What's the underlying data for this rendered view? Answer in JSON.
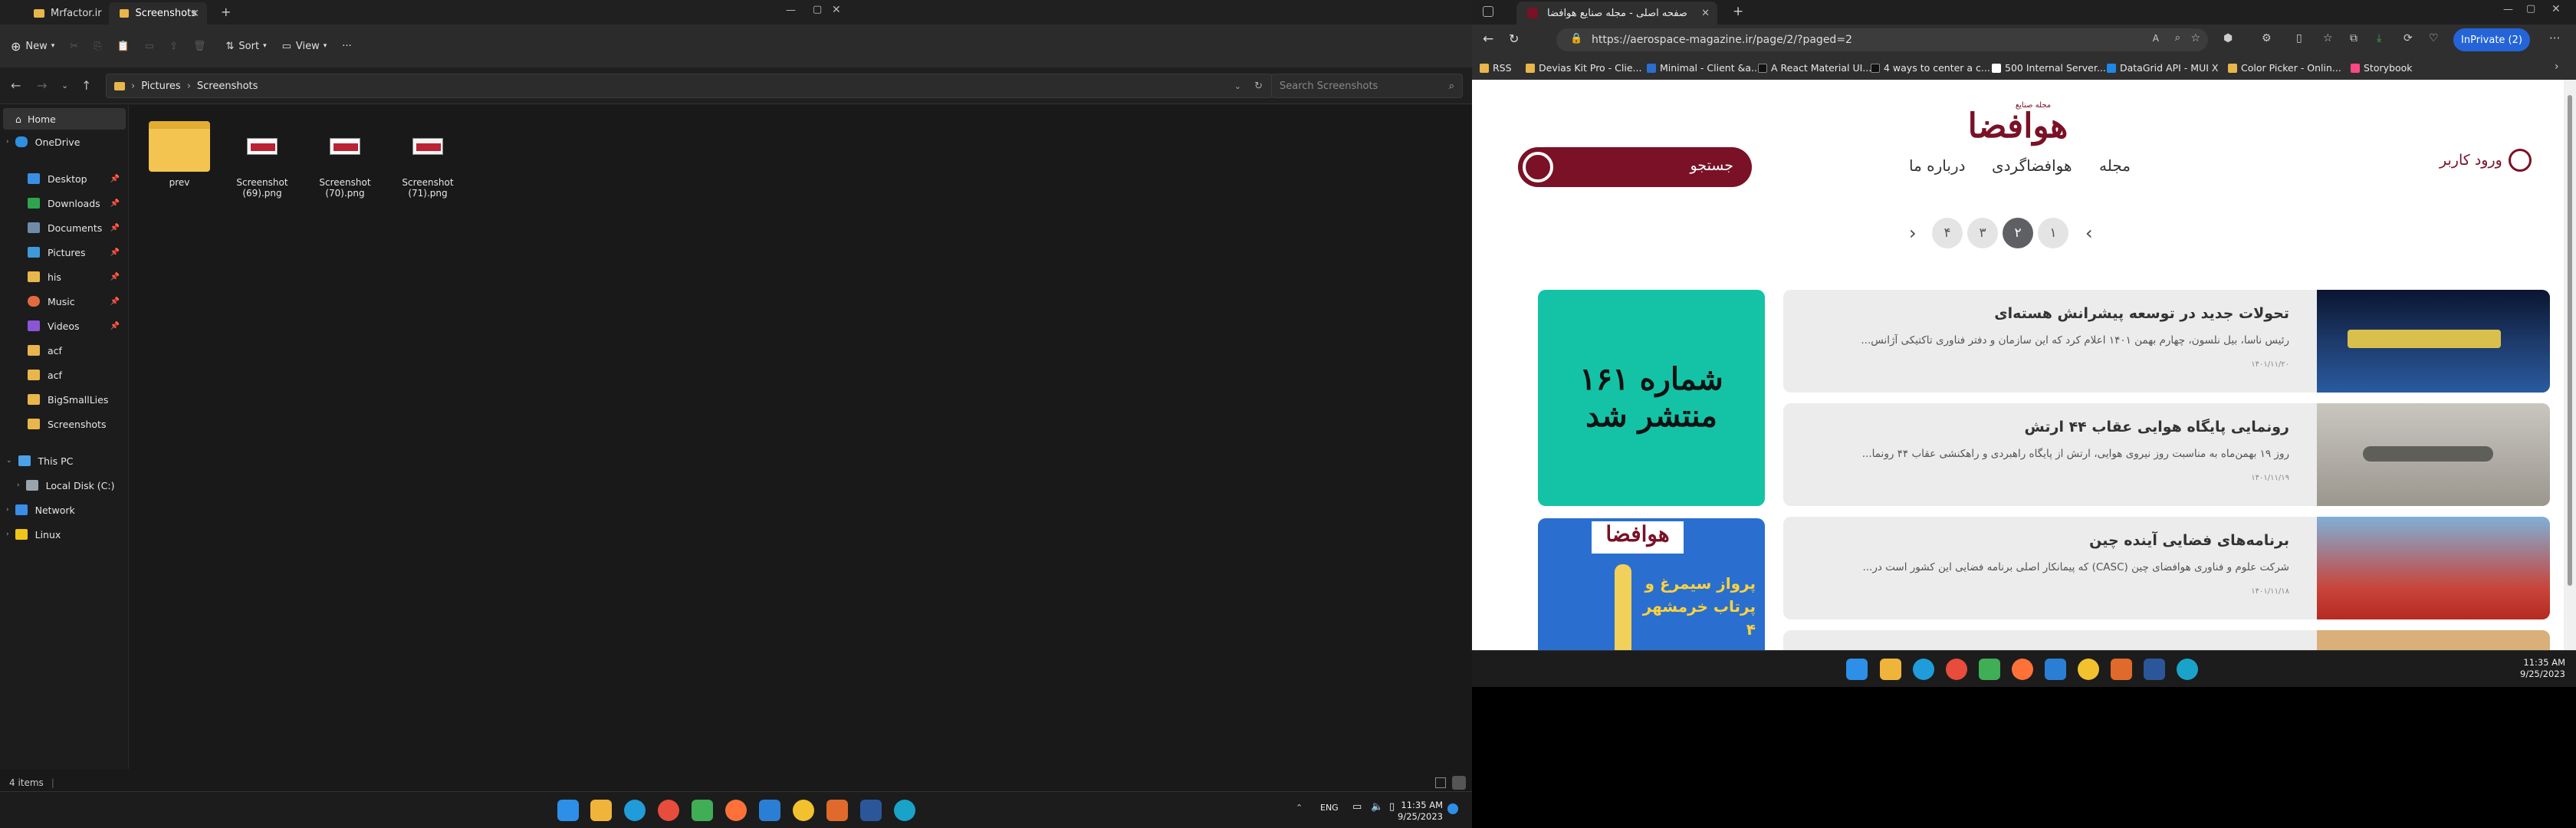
{
  "explorer": {
    "tabs": [
      {
        "label": "Mrfactor.ir"
      },
      {
        "label": "Screenshots"
      }
    ],
    "toolbar": {
      "new_label": "New",
      "sort_label": "Sort",
      "view_label": "View"
    },
    "breadcrumb": [
      "Pictures",
      "Screenshots"
    ],
    "search_placeholder": "Search Screenshots",
    "sidebar": {
      "home": "Home",
      "onedrive": "OneDrive",
      "pinned": [
        "Desktop",
        "Downloads",
        "Documents",
        "Pictures",
        "his",
        "Music",
        "Videos",
        "acf",
        "acf",
        "BigSmallLies",
        "Screenshots"
      ],
      "this_pc": "This PC",
      "local_disk": "Local Disk (C:)",
      "network": "Network",
      "linux": "Linux"
    },
    "files": [
      {
        "name": "prev",
        "kind": "folder"
      },
      {
        "name": "Screenshot (69).png",
        "kind": "image"
      },
      {
        "name": "Screenshot (70).png",
        "kind": "image"
      },
      {
        "name": "Screenshot (71).png",
        "kind": "image"
      }
    ],
    "status": "4 items"
  },
  "taskbar": {
    "lang": "ENG",
    "time": "11:35 AM",
    "date": "9/25/2023"
  },
  "browser": {
    "tab_title": "صفحه اصلی - مجله صنایع هوافضا",
    "url": "https://aerospace-magazine.ir/page/2/?paged=2",
    "inprivate_label": "InPrivate (2)",
    "bookmarks": [
      "RSS",
      "Devias Kit Pro - Clie...",
      "Minimal - Client &a...",
      "A React Material UI...",
      "4 ways to center a c...",
      "500 Internal Server...",
      "DataGrid API - MUI X",
      "Color Picker - Onlin...",
      "Storybook"
    ]
  },
  "site": {
    "logo_text": "هوافضا",
    "logo_tagline": "مجله صنایع",
    "login_label": "ورود کاربر",
    "nav": [
      "مجله",
      "هوافضاگردی",
      "درباره ما"
    ],
    "search_placeholder": "جستجو",
    "pages": [
      "۱",
      "۲",
      "۳",
      "۴"
    ],
    "current_page": "۲",
    "articles": [
      {
        "title": "تحولات جدید در توسعه پیشرانش هسته‌ای",
        "excerpt": "رئیس ناسا، بیل نلسون، چهارم بهمن ۱۴۰۱ اعلام کرد که این سازمان و دفتر فناوری تاکتیکی آژانس...",
        "date": "۱۴۰۱/۱۱/۲۰"
      },
      {
        "title": "رونمایی پایگاه هوایی عقاب ۴۴ ارتش",
        "excerpt": "روز ۱۹ بهمن‌ماه به مناسبت روز نیروی هوایی، ارتش از پایگاه راهبردی و راهکنشی عقاب ۴۴ رونما...",
        "date": "۱۴۰۱/۱۱/۱۹"
      },
      {
        "title": "برنامه‌های فضایی آینده چین",
        "excerpt": "شرکت علوم و فناوری هوافضای چین (CASC) که پیمانکار اصلی برنامه فضایی این کشور است در...",
        "date": "۱۴۰۱/۱۱/۱۸"
      }
    ],
    "promo_issue": "شماره ۱۶۱ منتشر شد",
    "promo_cover_title": "هوافضا",
    "promo_cover_text": "پرواز سیمرغ و پرتاب خرمشهر ۴"
  },
  "second_taskbar": {
    "time": "11:35 AM",
    "date": "9/25/2023"
  },
  "colors": {
    "brand": "#7a1126",
    "teal": "#14c3a6",
    "inprivate": "#2464d8"
  }
}
